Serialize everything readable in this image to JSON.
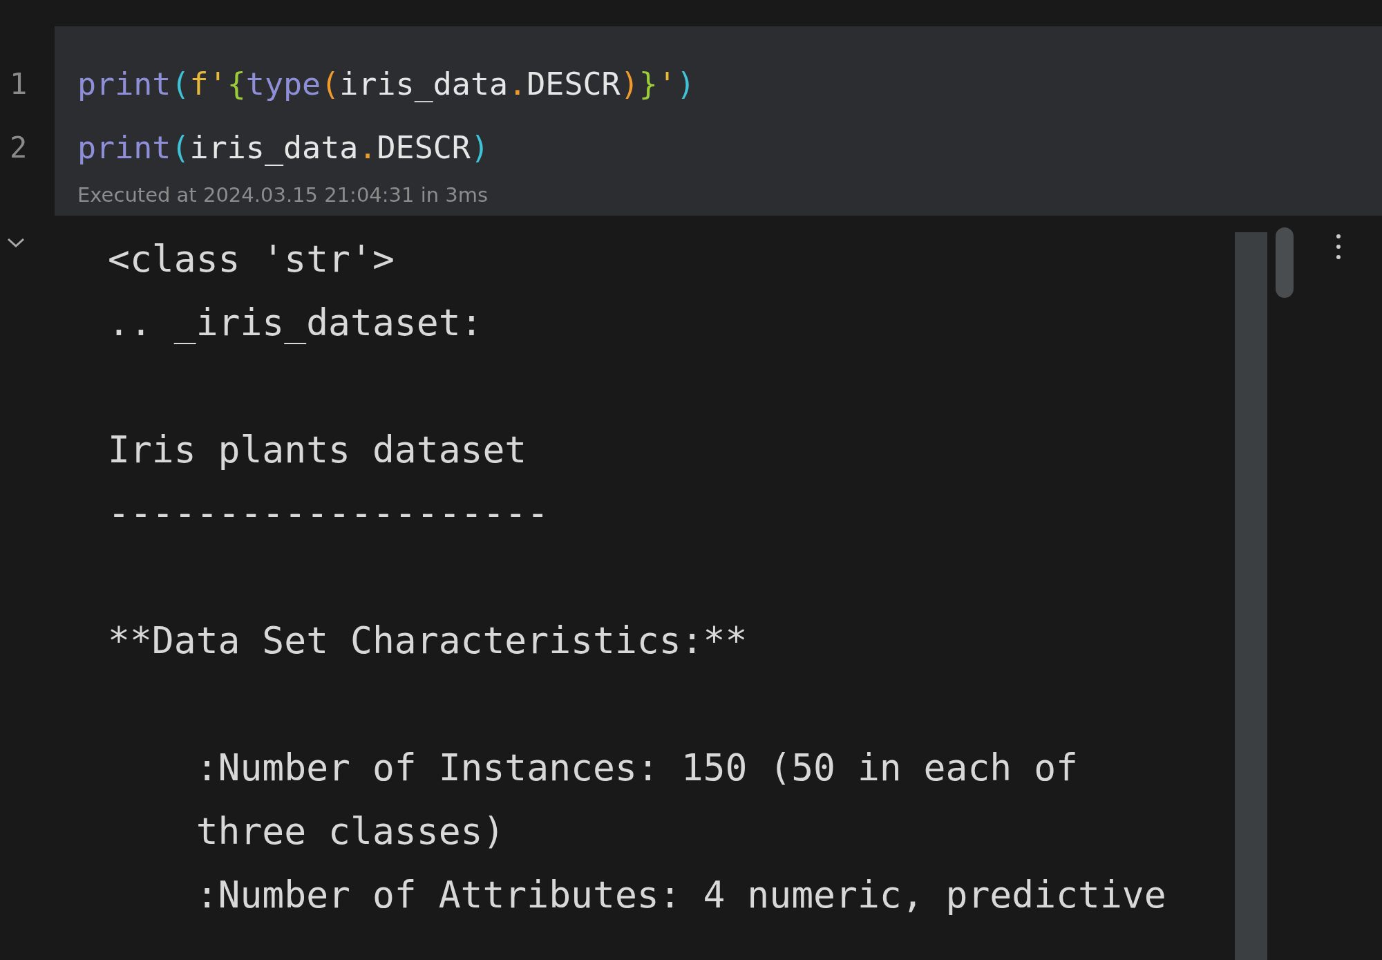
{
  "cell": {
    "lines": [
      {
        "number": "1",
        "tokens": [
          {
            "text": "print",
            "color": "#8f8fd9"
          },
          {
            "text": "(",
            "color": "#3fc1d6"
          },
          {
            "text": "f'",
            "color": "#e8b83a"
          },
          {
            "text": "{",
            "color": "#9ccc3a"
          },
          {
            "text": "type",
            "color": "#8f8fd9"
          },
          {
            "text": "(",
            "color": "#f09a2c"
          },
          {
            "text": "iris_data",
            "color": "#e6e6e6"
          },
          {
            "text": ".",
            "color": "#f09a2c"
          },
          {
            "text": "DESCR",
            "color": "#e6e6e6"
          },
          {
            "text": ")",
            "color": "#f09a2c"
          },
          {
            "text": "}",
            "color": "#9ccc3a"
          },
          {
            "text": "'",
            "color": "#e8b83a"
          },
          {
            "text": ")",
            "color": "#3fc1d6"
          }
        ]
      },
      {
        "number": "2",
        "tokens": [
          {
            "text": "print",
            "color": "#8f8fd9"
          },
          {
            "text": "(",
            "color": "#3fc1d6"
          },
          {
            "text": "iris_data",
            "color": "#e6e6e6"
          },
          {
            "text": ".",
            "color": "#f09a2c"
          },
          {
            "text": "DESCR",
            "color": "#e6e6e6"
          },
          {
            "text": ")",
            "color": "#3fc1d6"
          }
        ]
      }
    ],
    "status": "Executed at 2024.03.15 21:04:31 in 3ms"
  },
  "output": {
    "expanded": true,
    "lines": [
      {
        "kind": "text",
        "text": "<class 'str'>"
      },
      {
        "kind": "text",
        "text": ".. _iris_dataset:"
      },
      {
        "kind": "blank"
      },
      {
        "kind": "text",
        "text": "Iris plants dataset"
      },
      {
        "kind": "text",
        "text": "--------------------"
      },
      {
        "kind": "blank"
      },
      {
        "kind": "text",
        "text": "**Data Set Characteristics:**"
      },
      {
        "kind": "blank"
      },
      {
        "kind": "text",
        "text": "    :Number of Instances: 150 (50 in each of"
      },
      {
        "kind": "text",
        "text": "    three classes)"
      },
      {
        "kind": "text",
        "text": "    :Number of Attributes: 4 numeric, predictive"
      }
    ]
  }
}
